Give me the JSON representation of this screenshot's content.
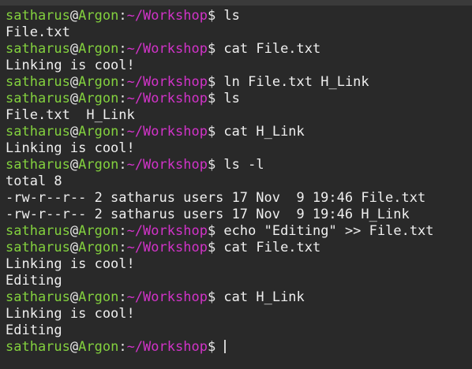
{
  "terminal": {
    "colors": {
      "background": "#292929",
      "user_host": "#83d13e",
      "path": "#d133c8",
      "text": "#efefef"
    },
    "prompt": {
      "user": "satharus",
      "at": "@",
      "host": "Argon",
      "colon": ":",
      "path": "~/Workshop",
      "dollar": "$ "
    },
    "lines": [
      {
        "type": "prompt",
        "cmd": "ls"
      },
      {
        "type": "out",
        "text": "File.txt"
      },
      {
        "type": "prompt",
        "cmd": "cat File.txt"
      },
      {
        "type": "out",
        "text": "Linking is cool!"
      },
      {
        "type": "prompt",
        "cmd": "ln File.txt H_Link"
      },
      {
        "type": "prompt",
        "cmd": "ls"
      },
      {
        "type": "out",
        "text": "File.txt  H_Link"
      },
      {
        "type": "prompt",
        "cmd": "cat H_Link"
      },
      {
        "type": "out",
        "text": "Linking is cool!"
      },
      {
        "type": "prompt",
        "cmd": "ls -l"
      },
      {
        "type": "out",
        "text": "total 8"
      },
      {
        "type": "out",
        "text": "-rw-r--r-- 2 satharus users 17 Nov  9 19:46 File.txt"
      },
      {
        "type": "out",
        "text": "-rw-r--r-- 2 satharus users 17 Nov  9 19:46 H_Link"
      },
      {
        "type": "prompt",
        "cmd": "echo \"Editing\" >> File.txt"
      },
      {
        "type": "prompt",
        "cmd": "cat File.txt"
      },
      {
        "type": "out",
        "text": "Linking is cool!"
      },
      {
        "type": "out",
        "text": "Editing"
      },
      {
        "type": "prompt",
        "cmd": "cat H_Link"
      },
      {
        "type": "out",
        "text": "Linking is cool!"
      },
      {
        "type": "out",
        "text": "Editing"
      },
      {
        "type": "prompt",
        "cmd": ""
      }
    ]
  }
}
